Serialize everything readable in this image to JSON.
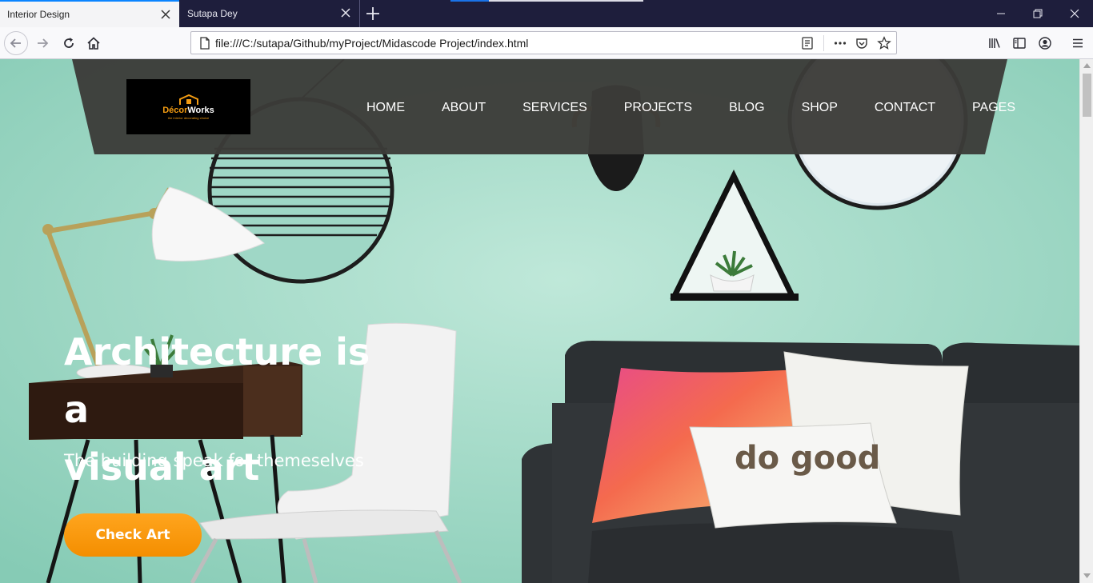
{
  "browser": {
    "tabs": [
      {
        "title": "Interior Design",
        "active": true
      },
      {
        "title": "Sutapa Dey",
        "active": false
      }
    ],
    "url": "file:///C:/sutapa/Github/myProject/Midascode Project/index.html",
    "icons": {
      "back": "back-arrow-icon",
      "forward": "forward-arrow-icon",
      "reload": "reload-icon",
      "home": "home-icon",
      "page": "page-icon",
      "reader": "reader-view-icon",
      "more": "more-dots-icon",
      "pocket": "pocket-icon",
      "bookmark": "star-icon",
      "library": "library-icon",
      "sidebar": "sidebar-icon",
      "account": "account-icon",
      "menu": "hamburger-menu-icon"
    }
  },
  "site": {
    "logo": {
      "brand_accent": "Décor",
      "brand_main": "Works",
      "tagline": "the interior decorating choice"
    },
    "nav": [
      "HOME",
      "ABOUT",
      "SERVICES",
      "PROJECTS",
      "BLOG",
      "SHOP",
      "CONTACT",
      "PAGES"
    ],
    "hero": {
      "title_line1": "Architecture is a",
      "title_line2": "visual art",
      "subtitle": "The building speak for themeselves",
      "cta": "Check Art"
    }
  },
  "colors": {
    "wall": "#a7dccb",
    "header_band": "#3b3b38",
    "cta": "#f7941d",
    "accent_orange": "#f39c12"
  }
}
